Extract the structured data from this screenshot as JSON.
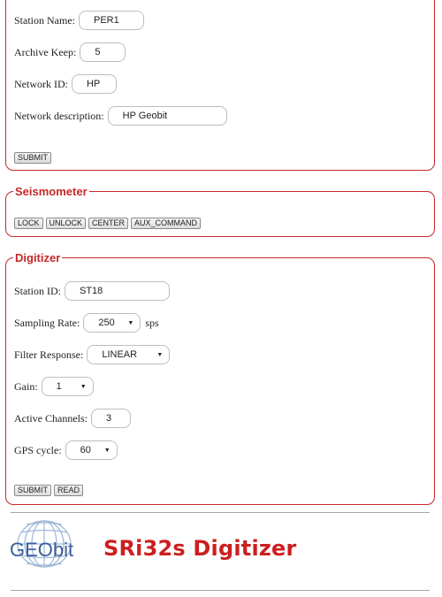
{
  "station": {
    "name_label": "Station Name:",
    "name_value": "PER1",
    "archive_label": "Archive Keep:",
    "archive_value": "5",
    "netid_label": "Network ID:",
    "netid_value": "HP",
    "netdesc_label": "Network description:",
    "netdesc_value": "HP Geobit",
    "submit_label": "SUBMIT"
  },
  "seismometer": {
    "legend": "Seismometer",
    "buttons": [
      "LOCK",
      "UNLOCK",
      "CENTER",
      "AUX_COMMAND"
    ]
  },
  "digitizer": {
    "legend": "Digitizer",
    "station_id_label": "Station ID:",
    "station_id_value": "ST18",
    "sampling_label": "Sampling Rate:",
    "sampling_value": "250",
    "sampling_unit": "sps",
    "filter_label": "Filter Response:",
    "filter_value": "LINEAR",
    "gain_label": "Gain:",
    "gain_value": "1",
    "channels_label": "Active Channels:",
    "channels_value": "3",
    "gps_label": "GPS cycle:",
    "gps_value": "60",
    "submit_label": "SUBMIT",
    "read_label": "READ"
  },
  "footer": {
    "logo_text": "GEObit",
    "product_title": "SRi32s Digitizer"
  },
  "colors": {
    "accent": "#c62828",
    "title": "#cc1f1f",
    "logo_blue": "#3a5f9a"
  },
  "icons": {
    "caret": "chevron-down-icon",
    "logo": "globe-logo-icon"
  }
}
